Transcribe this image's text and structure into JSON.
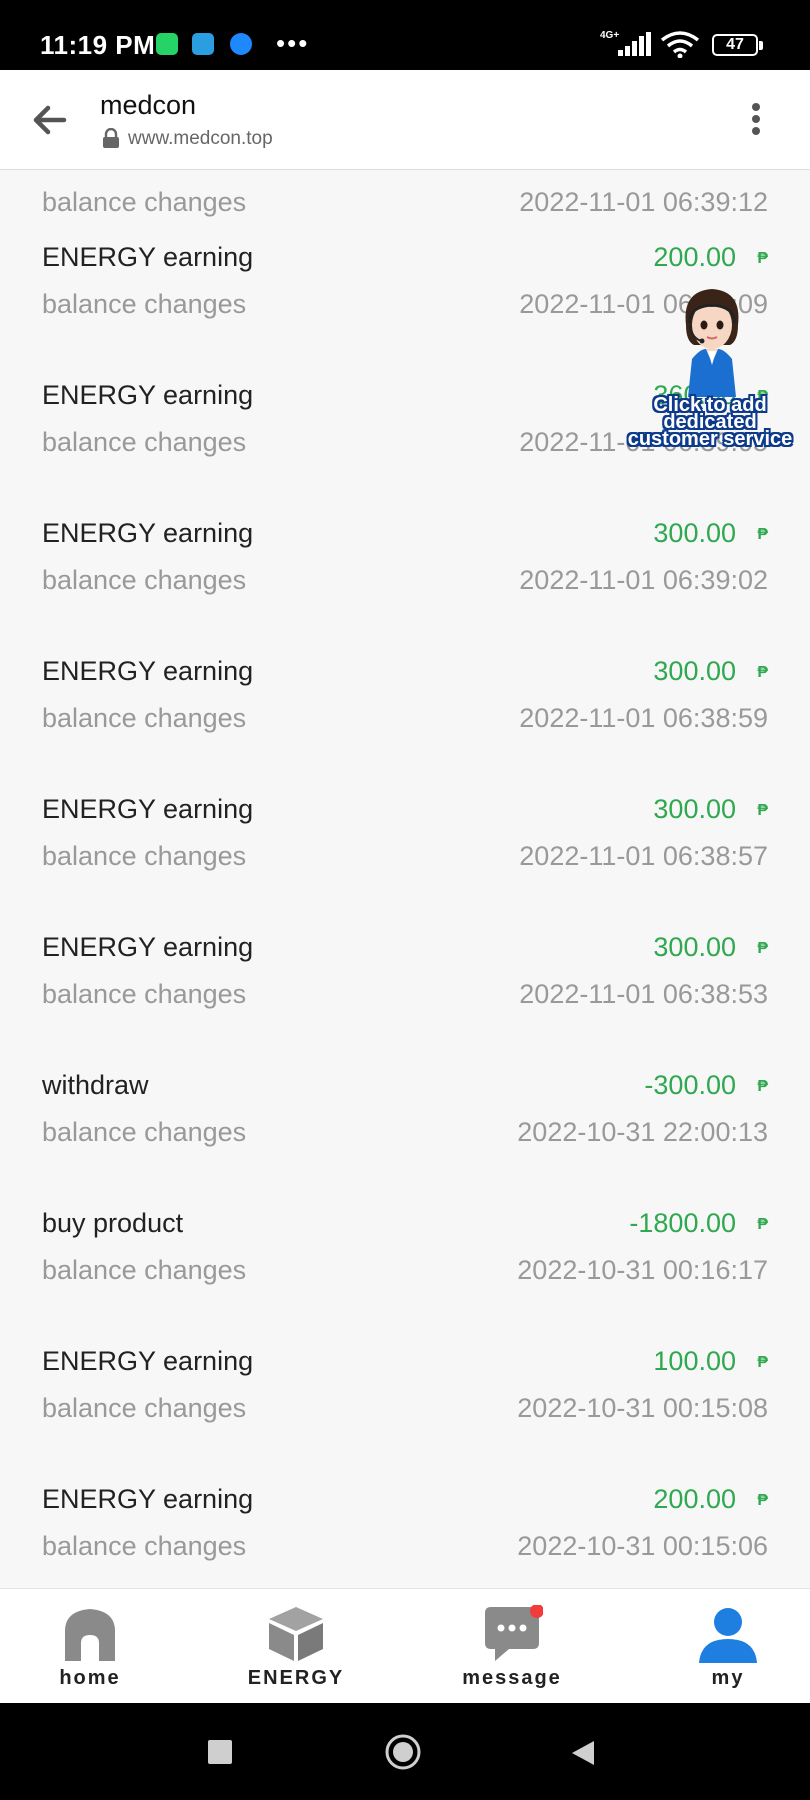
{
  "status_bar": {
    "time": "11:19 PM",
    "network": "4G+",
    "battery": "47"
  },
  "browser": {
    "title": "medcon",
    "url": "www.medcon.top"
  },
  "records": [
    {
      "title": "",
      "subtitle": "balance changes",
      "amount": "",
      "currency": "",
      "timestamp": "2022-11-01 06:39:12"
    },
    {
      "title": "ENERGY earning",
      "subtitle": "balance changes",
      "amount": "200.00",
      "currency": "₱",
      "timestamp": "2022-11-01 06:39:09"
    },
    {
      "title": "ENERGY earning",
      "subtitle": "balance changes",
      "amount": "360.00",
      "currency": "₱",
      "timestamp": "2022-11-01 06:39:05"
    },
    {
      "title": "ENERGY earning",
      "subtitle": "balance changes",
      "amount": "300.00",
      "currency": "₱",
      "timestamp": "2022-11-01 06:39:02"
    },
    {
      "title": "ENERGY earning",
      "subtitle": "balance changes",
      "amount": "300.00",
      "currency": "₱",
      "timestamp": "2022-11-01 06:38:59"
    },
    {
      "title": "ENERGY earning",
      "subtitle": "balance changes",
      "amount": "300.00",
      "currency": "₱",
      "timestamp": "2022-11-01 06:38:57"
    },
    {
      "title": "ENERGY earning",
      "subtitle": "balance changes",
      "amount": "300.00",
      "currency": "₱",
      "timestamp": "2022-11-01 06:38:53"
    },
    {
      "title": "withdraw",
      "subtitle": "balance changes",
      "amount": "-300.00",
      "currency": "₱",
      "timestamp": "2022-10-31 22:00:13"
    },
    {
      "title": "buy product",
      "subtitle": "balance changes",
      "amount": "-1800.00",
      "currency": "₱",
      "timestamp": "2022-10-31 00:16:17"
    },
    {
      "title": "ENERGY earning",
      "subtitle": "balance changes",
      "amount": "100.00",
      "currency": "₱",
      "timestamp": "2022-10-31 00:15:08"
    },
    {
      "title": "ENERGY earning",
      "subtitle": "balance changes",
      "amount": "200.00",
      "currency": "₱",
      "timestamp": "2022-10-31 00:15:06"
    }
  ],
  "customer_service": {
    "line1": "Click to add",
    "line2": "dedicated",
    "line3": "customer service"
  },
  "tabs": [
    {
      "label": "home",
      "icon": "home-icon",
      "color": "#8a8a8a"
    },
    {
      "label": "ENERGY",
      "icon": "box-icon",
      "color": "#8a8a8a"
    },
    {
      "label": "message",
      "icon": "message-icon",
      "color": "#8a8a8a",
      "badge": true
    },
    {
      "label": "my",
      "icon": "user-icon",
      "color": "#1e7fe0"
    }
  ],
  "colors": {
    "positive": "#2fa84f",
    "muted": "#999999",
    "accent": "#1e7fe0",
    "badge": "#f03c3c"
  }
}
